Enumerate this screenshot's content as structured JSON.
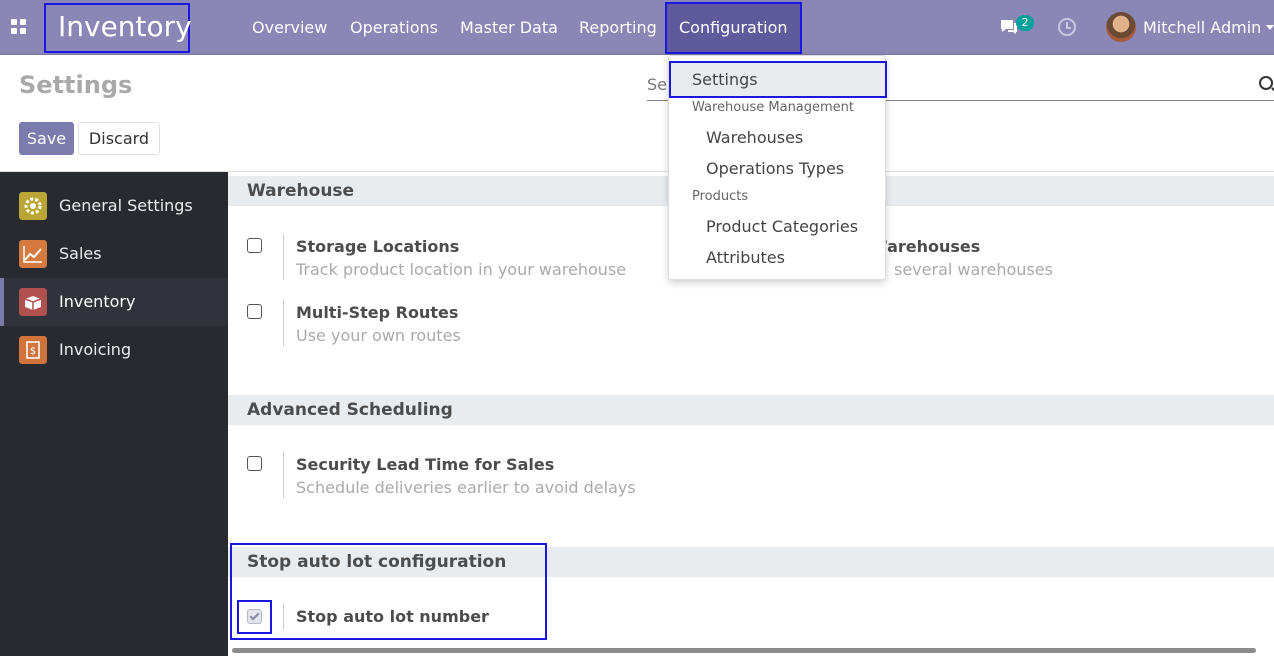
{
  "navbar": {
    "brand": "Inventory",
    "menus": [
      "Overview",
      "Operations",
      "Master Data",
      "Reporting",
      "Configuration"
    ],
    "messages_count": "2",
    "user_name": "Mitchell Admin"
  },
  "control_panel": {
    "title": "Settings",
    "save_label": "Save",
    "discard_label": "Discard",
    "search_placeholder": "Se"
  },
  "sidebar": {
    "items": [
      {
        "label": "General Settings",
        "icon": "gear-icon",
        "color": "#b9a635"
      },
      {
        "label": "Sales",
        "icon": "chart-icon",
        "color": "#d47a3e"
      },
      {
        "label": "Inventory",
        "icon": "box-icon",
        "color": "#b0514f"
      },
      {
        "label": "Invoicing",
        "icon": "invoice-icon",
        "color": "#d0743c"
      }
    ]
  },
  "sections": {
    "warehouse": {
      "title": "Warehouse",
      "settings": [
        {
          "title": "Storage Locations",
          "desc": "Track product location in your warehouse",
          "checked": false
        },
        {
          "title": "Multi-Warehouses",
          "title_visible": "Warehouses",
          "desc_visible": "several warehouses",
          "checked": false
        },
        {
          "title": "Multi-Step Routes",
          "desc": "Use your own routes",
          "checked": false
        }
      ]
    },
    "advanced_scheduling": {
      "title": "Advanced Scheduling",
      "settings": [
        {
          "title": "Security Lead Time for Sales",
          "desc": "Schedule deliveries earlier to avoid delays",
          "checked": false
        }
      ]
    },
    "stop_auto_lot": {
      "title": "Stop auto lot configuration",
      "settings": [
        {
          "title": "Stop auto lot number",
          "checked": true
        }
      ]
    }
  },
  "config_dropdown": {
    "settings": "Settings",
    "warehouse_header": "Warehouse Management",
    "warehouses": "Warehouses",
    "operation_types": "Operations Types",
    "products_header": "Products",
    "product_categories": "Product Categories",
    "attributes": "Attributes"
  },
  "colors": {
    "navbar": "#8a86b5",
    "primary_button": "#7c7bad",
    "sidebar_bg": "#272a2f",
    "highlight": "#1a18e0"
  }
}
